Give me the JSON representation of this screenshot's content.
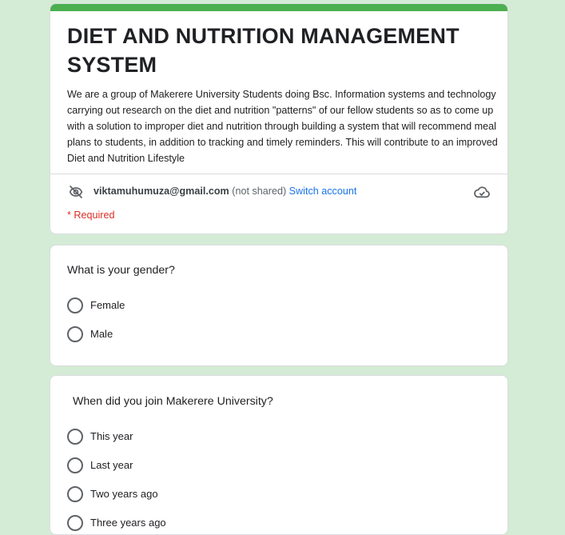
{
  "form": {
    "title": "DIET AND NUTRITION MANAGEMENT SYSTEM",
    "description": "We are a group of Makerere University Students doing Bsc. Information systems and technology carrying out research on the  diet and nutrition  \"patterns\" of our fellow students so as to come up with a solution to improper diet and nutrition through building a system that will recommend meal plans to students, in addition to tracking and timely reminders. This will contribute to an improved Diet and Nutrition Lifestyle",
    "accent_color": "#4caf50"
  },
  "account": {
    "email": "viktamuhumuza@gmail.com",
    "not_shared": "(not shared)",
    "switch_label": "Switch account"
  },
  "required_note": "* Required",
  "questions": [
    {
      "title": "What is your gender?",
      "options": [
        "Female",
        "Male"
      ]
    },
    {
      "title": "When did you join Makerere University?",
      "options": [
        "This year",
        "Last year",
        "Two years ago",
        "Three years ago"
      ]
    }
  ],
  "icons": {
    "visibility": "visibility-off-icon",
    "cloud": "cloud-done-icon"
  },
  "colors": {
    "background": "#d4ecd5",
    "link": "#1a73e8",
    "required": "#d93025"
  }
}
